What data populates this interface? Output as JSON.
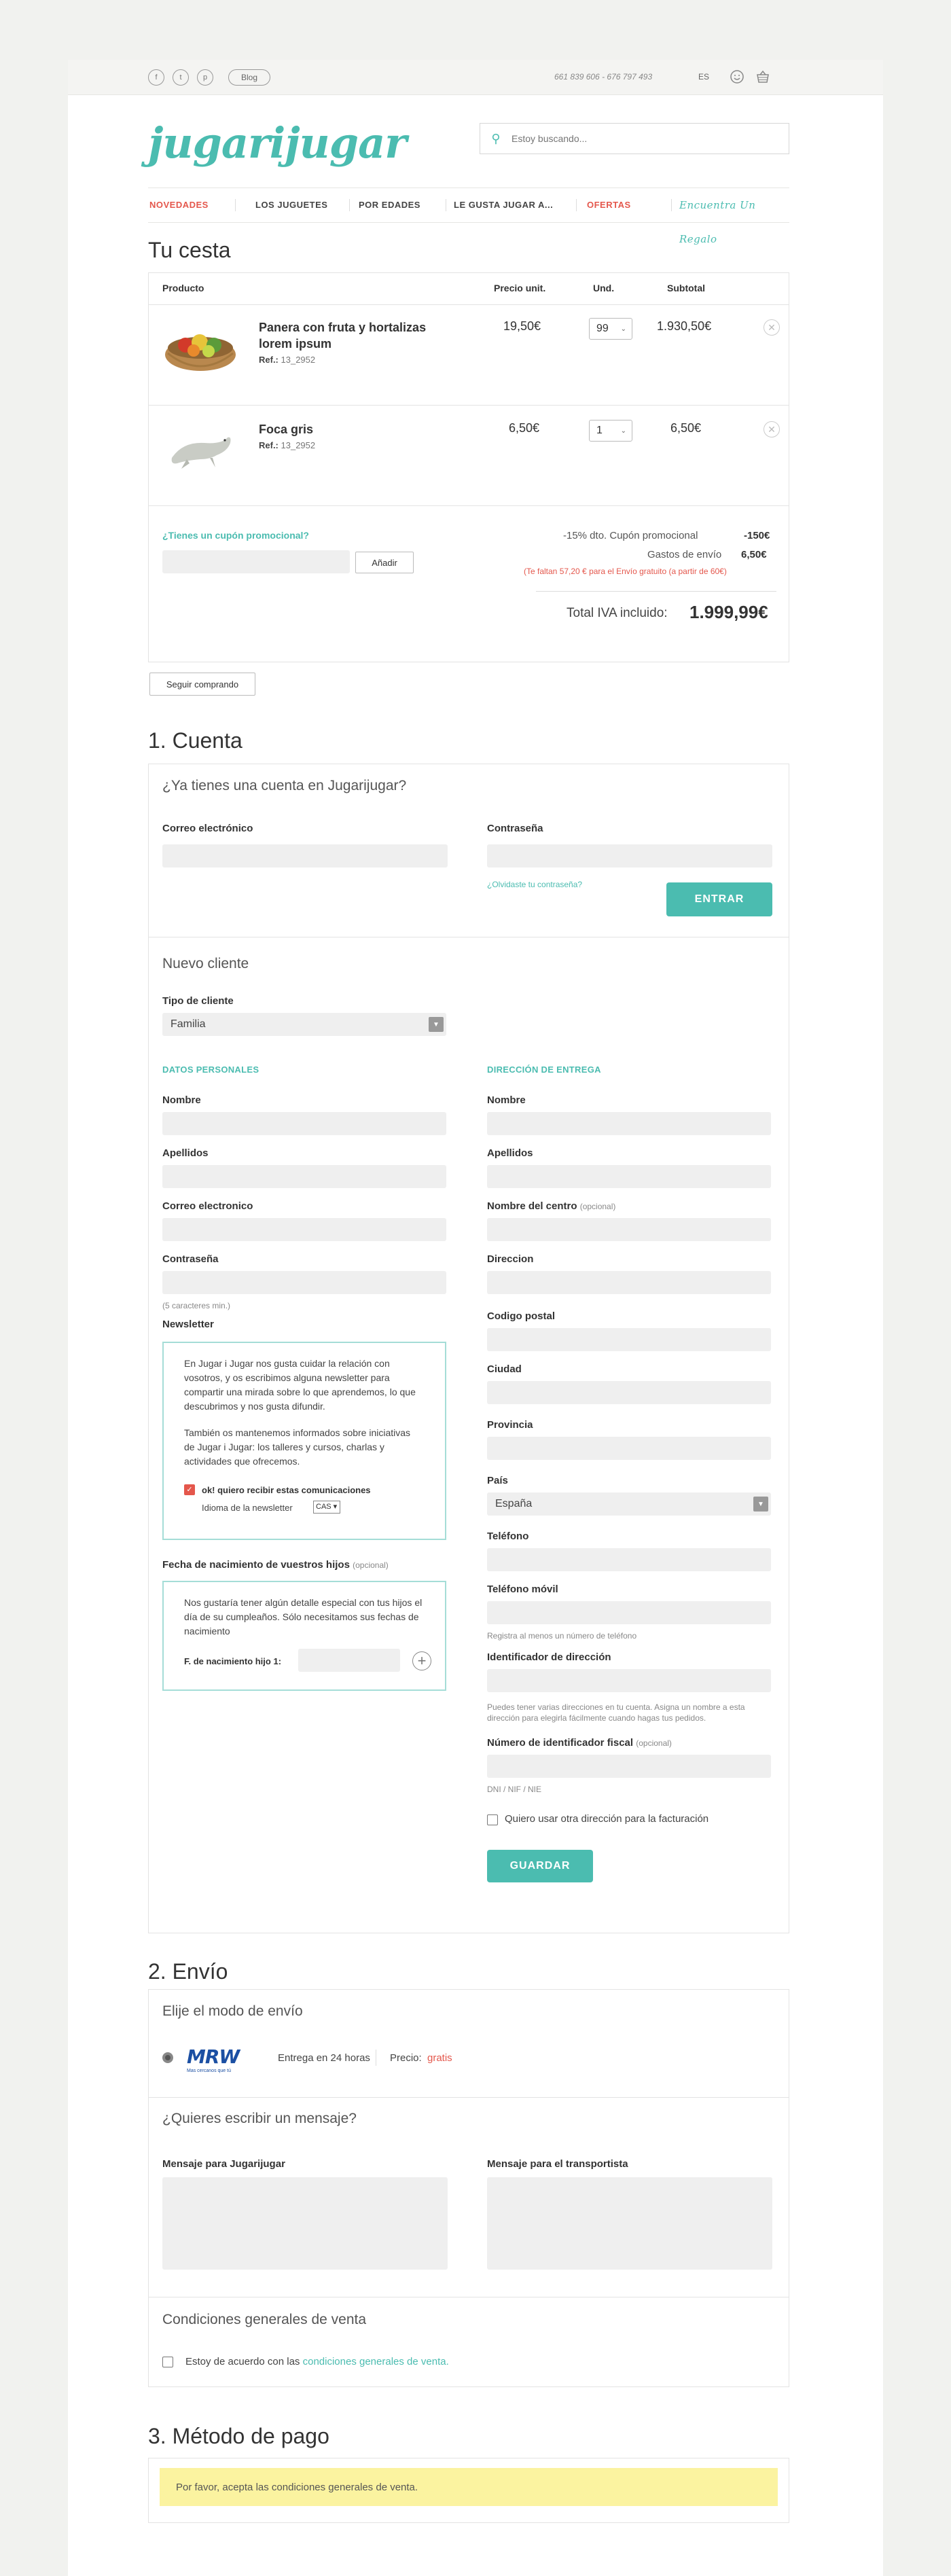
{
  "topbar": {
    "social": [
      "f",
      "t",
      "p"
    ],
    "blog": "Blog",
    "phones": "661 839 606 - 676 797 493",
    "lang": "ES",
    "icons": [
      "smiley-icon",
      "basket-icon"
    ]
  },
  "header": {
    "logo": "jugarijugar",
    "search_placeholder": "Estoy buscando..."
  },
  "nav": {
    "items": [
      "NOVEDADES",
      "LOS JUGUETES",
      "POR EDADES",
      "LE GUSTA JUGAR A...",
      "OFERTAS"
    ],
    "gift": "Encuentra Un Regalo"
  },
  "cart": {
    "title": "Tu cesta",
    "headers": {
      "product": "Producto",
      "unit": "Precio unit.",
      "qty": "Und.",
      "subtotal": "Subtotal"
    },
    "products": [
      {
        "name": "Panera con fruta y hortalizas lorem ipsum",
        "ref_label": "Ref.:",
        "ref": "13_2952",
        "unit": "19,50€",
        "qty": "99",
        "subtotal": "1.930,50€"
      },
      {
        "name": "Foca gris",
        "ref_label": "Ref.:",
        "ref": "13_2952",
        "unit": "6,50€",
        "qty": "1",
        "subtotal": "6,50€"
      }
    ],
    "coupon_question": "¿Tienes un cupón promocional?",
    "add_button": "Añadir",
    "discount_label": "-15% dto. Cupón promocional",
    "discount_value": "-150€",
    "shipping_label": "Gastos de envío",
    "shipping_value": "6,50€",
    "free_shipping_note": "(Te faltan 57,20 € para el Envío gratuito (a partir de 60€)",
    "total_label": "Total IVA incluido:",
    "total_value": "1.999,99€",
    "continue_button": "Seguir comprando"
  },
  "account": {
    "title": "1. Cuenta",
    "login_heading": "¿Ya tienes una cuenta en Jugarijugar?",
    "email_label": "Correo electrónico",
    "password_label": "Contraseña",
    "forgot": "¿Olvidaste tu contraseña?",
    "enter_button": "ENTRAR",
    "new_customer": "Nuevo cliente",
    "customer_type_label": "Tipo de cliente",
    "customer_type_value": "Familia",
    "personal_heading": "DATOS PERSONALES",
    "delivery_heading": "DIRECCIÓN DE ENTREGA",
    "personal": {
      "name": "Nombre",
      "surname": "Apellidos",
      "email": "Correo electronico",
      "password": "Contraseña",
      "password_hint": "(5 caracteres min.)"
    },
    "newsletter_label": "Newsletter",
    "newsletter_p1": "En Jugar i Jugar nos gusta cuidar la relación con vosotros, y os escribimos alguna newsletter para compartir una mirada sobre lo que aprendemos, lo que descubrimos y nos gusta difundir.",
    "newsletter_p2": "También os mantenemos informados sobre iniciativas de Jugar i Jugar: los talleres y cursos, charlas y actividades que ofrecemos.",
    "newsletter_check": "ok! quiero recibir estas comunicaciones",
    "newsletter_lang_label": "Idioma de la newsletter",
    "newsletter_lang_value": "CAS",
    "birth_label": "Fecha de nacimiento de vuestros hijos",
    "optional": "(opcional)",
    "birth_text": "Nos gustaría tener algún detalle especial con tus hijos el día de su cumpleaños. Sólo necesitamos sus fechas de nacimiento",
    "birth_field": "F. de nacimiento hijo 1:",
    "delivery": {
      "name": "Nombre",
      "surname": "Apellidos",
      "center": "Nombre del centro",
      "address": "Direccion",
      "zip": "Codigo postal",
      "city": "Ciudad",
      "province": "Provincia",
      "country": "País",
      "country_value": "España",
      "phone": "Teléfono",
      "mobile": "Teléfono móvil",
      "mobile_hint": "Registra al menos un número de teléfono",
      "address_id": "Identificador de dirección",
      "address_id_hint": "Puedes tener varias direcciones en tu cuenta. Asigna un nombre a esta dirección para elegirla fácilmente cuando hagas tus pedidos.",
      "tax_id": "Número de identificador fiscal",
      "tax_hint": "DNI / NIF / NIE",
      "billing_check": "Quiero usar otra dirección para la facturación",
      "save_button": "GUARDAR"
    }
  },
  "shipping": {
    "title": "2. Envío",
    "mode_heading": "Elije el modo de envío",
    "carrier": "MRW",
    "carrier_tagline": "Mas cercanos que tú",
    "delivery_time": "Entrega en 24 horas",
    "price_label": "Precio:",
    "price_value": "gratis",
    "message_heading": "¿Quieres escribir un mensaje?",
    "msg_store": "Mensaje para Jugarijugar",
    "msg_carrier": "Mensaje para el transportista",
    "terms_heading": "Condiciones generales de venta",
    "terms_text": "Estoy de acuerdo con las",
    "terms_link": "condiciones generales de venta."
  },
  "payment": {
    "title": "3. Método de pago",
    "warning": "Por favor, acepta las condiciones generales de venta."
  },
  "colors": {
    "accent": "#4bbcb0",
    "red": "#e4574c",
    "warning_bg": "#fbf3a0"
  }
}
